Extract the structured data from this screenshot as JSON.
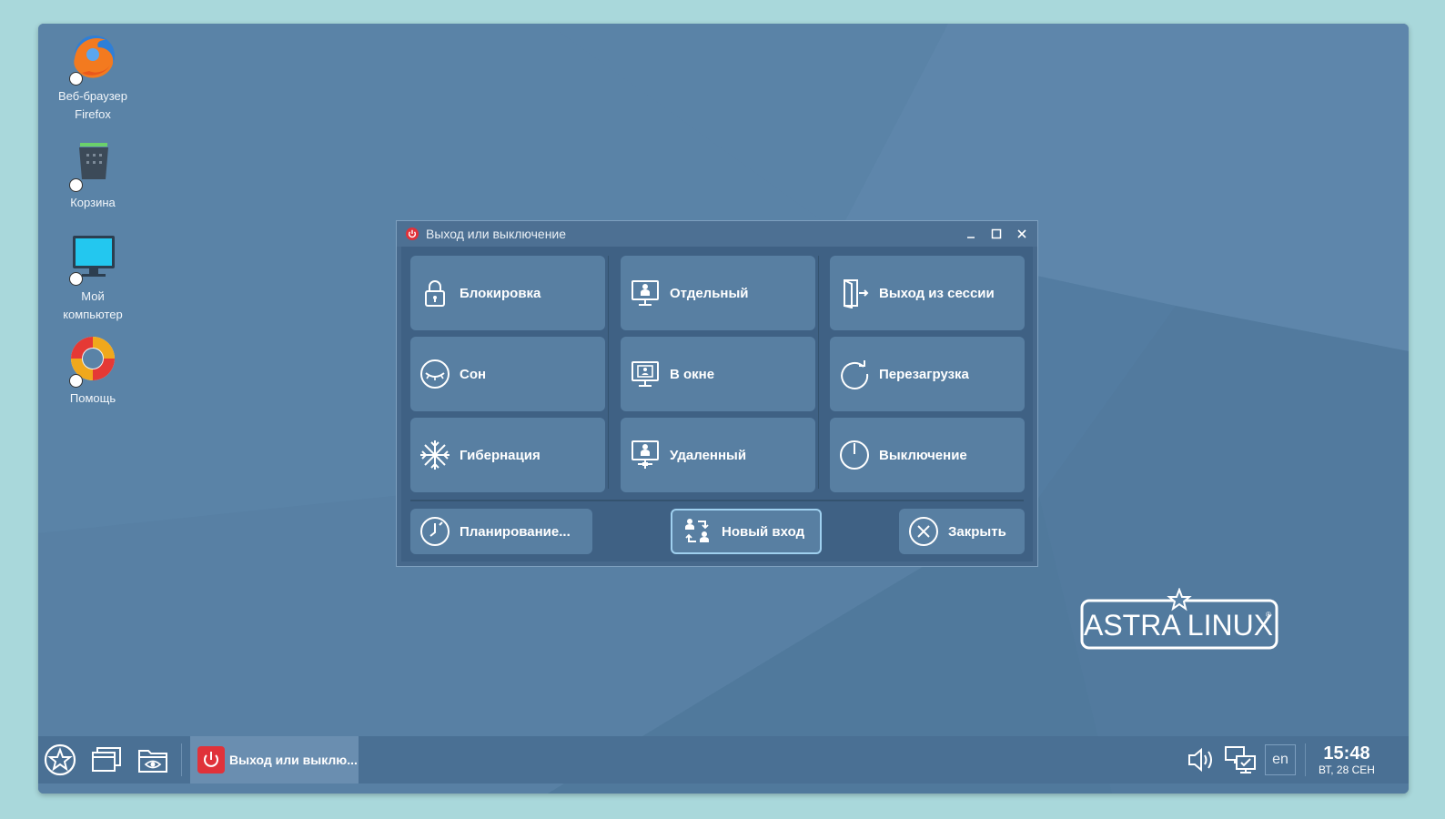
{
  "desktop": {
    "icons": [
      {
        "label_line1": "Веб-браузер",
        "label_line2": "Firefox",
        "icon": "firefox-icon"
      },
      {
        "label_line1": "Корзина",
        "label_line2": "",
        "icon": "trash-icon"
      },
      {
        "label_line1": "Мой",
        "label_line2": "компьютер",
        "icon": "computer-icon"
      },
      {
        "label_line1": "Помощь",
        "label_line2": "",
        "icon": "help-lifebuoy-icon"
      }
    ],
    "logo_text": "ASTRA LINUX",
    "logo_mark": "®"
  },
  "dialog": {
    "title": "Выход или выключение",
    "tiles": {
      "lock": "Блокировка",
      "separate": "Отдельный",
      "logout": "Выход из сессии",
      "sleep": "Сон",
      "in_window": "В окне",
      "reboot": "Перезагрузка",
      "hibernate": "Гибернация",
      "remote": "Удаленный",
      "shutdown": "Выключение"
    },
    "buttons": {
      "schedule": "Планирование...",
      "new_login": "Новый вход",
      "close": "Закрыть"
    }
  },
  "taskbar": {
    "task_label": "Выход или выклю...",
    "language": "en",
    "time": "15:48",
    "date": "ВТ, 28 СЕН"
  },
  "colors": {
    "desktop": "#5a83a7",
    "dialog": "#47698c",
    "tile": "#587fa2",
    "taskbar": "#4a7094",
    "accent_red": "#e0323a"
  }
}
